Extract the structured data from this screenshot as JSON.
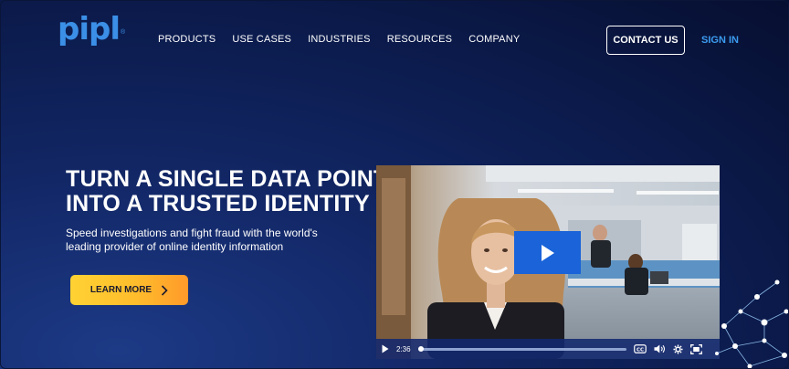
{
  "brand": {
    "logo_text": "pipl",
    "logo_mark": "®",
    "logo_color": "#3b8fe6"
  },
  "nav": {
    "items": [
      {
        "label": "PRODUCTS",
        "name": "nav-item-products"
      },
      {
        "label": "USE CASES",
        "name": "nav-item-use-cases"
      },
      {
        "label": "INDUSTRIES",
        "name": "nav-item-industries"
      },
      {
        "label": "RESOURCES",
        "name": "nav-item-resources"
      },
      {
        "label": "COMPANY",
        "name": "nav-item-company"
      }
    ],
    "contact_label": "CONTACT US",
    "signin_label": "SIGN IN"
  },
  "hero": {
    "title_line1": "TURN A SINGLE DATA POINT",
    "title_line2": "INTO A TRUSTED IDENTITY",
    "subtitle_line1": "Speed investigations and fight fraud with the world's",
    "subtitle_line2": "leading provider of online identity information",
    "cta_label": "LEARN MORE",
    "cta_icon": "chevron-right-icon"
  },
  "video": {
    "time": "2:36",
    "progress": 0.0,
    "icons": [
      "play-icon",
      "closed-captions-icon",
      "volume-icon",
      "settings-icon",
      "fullscreen-icon"
    ],
    "play_button_color": "#1a63d8"
  },
  "colors": {
    "background": "#0b1a4a",
    "accent_blue": "#3b9cf0",
    "cta_gradient_start": "#ffd233",
    "cta_gradient_end": "#ff9a2a"
  }
}
